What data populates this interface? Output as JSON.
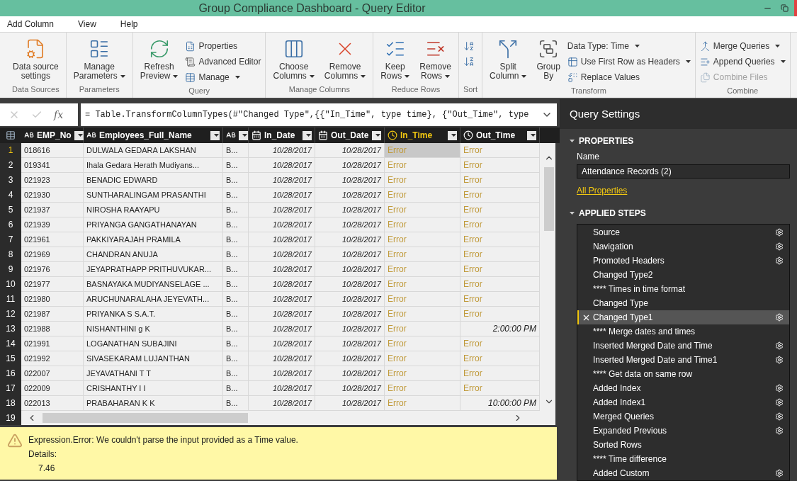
{
  "window": {
    "title": "Group Compliance Dashboard - Query Editor"
  },
  "menu": [
    {
      "label": "Add Column",
      "selected": false
    },
    {
      "label": "View",
      "selected": false
    },
    {
      "label": "Help",
      "selected": false
    }
  ],
  "ribbon": [
    {
      "label": "Data Sources",
      "items": [
        {
          "kind": "large",
          "lines": [
            "Data source",
            "settings"
          ],
          "dropdown": false
        }
      ]
    },
    {
      "label": "Parameters",
      "items": [
        {
          "kind": "large",
          "lines": [
            "Manage",
            "Parameters"
          ],
          "dropdown": true
        }
      ]
    },
    {
      "label": "Query",
      "items": [
        {
          "kind": "large",
          "lines": [
            "Refresh",
            "Preview"
          ],
          "dropdown": true
        },
        {
          "kind": "small",
          "label": "Properties",
          "dropdown": false,
          "disabled": false
        },
        {
          "kind": "small",
          "label": "Advanced Editor",
          "dropdown": false,
          "disabled": false
        },
        {
          "kind": "small",
          "label": "Manage",
          "dropdown": true,
          "disabled": false
        }
      ]
    },
    {
      "label": "Manage Columns",
      "items": [
        {
          "kind": "large",
          "lines": [
            "Choose",
            "Columns"
          ],
          "dropdown": true
        },
        {
          "kind": "large",
          "lines": [
            "Remove",
            "Columns"
          ],
          "dropdown": true
        }
      ]
    },
    {
      "label": "Reduce Rows",
      "items": [
        {
          "kind": "large",
          "lines": [
            "Keep",
            "Rows"
          ],
          "dropdown": true
        },
        {
          "kind": "large",
          "lines": [
            "Remove",
            "Rows"
          ],
          "dropdown": true
        }
      ]
    },
    {
      "label": "Sort",
      "items": [
        {
          "kind": "icon"
        },
        {
          "kind": "icon"
        }
      ]
    },
    {
      "label": "Transform",
      "items": [
        {
          "kind": "large",
          "lines": [
            "Split",
            "Column"
          ],
          "dropdown": true
        },
        {
          "kind": "large",
          "lines": [
            "Group",
            "By"
          ],
          "dropdown": false
        },
        {
          "kind": "small",
          "label": "Data Type: Time",
          "dropdown": true,
          "disabled": false
        },
        {
          "kind": "small",
          "label": "Use First Row as Headers",
          "dropdown": true,
          "disabled": false
        },
        {
          "kind": "small",
          "label": "Replace Values",
          "dropdown": false,
          "disabled": false
        }
      ]
    },
    {
      "label": "Combine",
      "items": [
        {
          "kind": "small",
          "label": "Merge Queries",
          "dropdown": true,
          "disabled": false
        },
        {
          "kind": "small",
          "label": "Append Queries",
          "dropdown": true,
          "disabled": false
        },
        {
          "kind": "small",
          "label": "Combine Files",
          "dropdown": false,
          "disabled": true
        }
      ]
    }
  ],
  "formula_bar": {
    "fx": "fx",
    "formula": "= Table.TransformColumnTypes(#\"Changed Type\",{{\"In_Time\", type time}, {\"Out_Time\", type"
  },
  "table": {
    "columns": [
      {
        "label": "EMP_No",
        "kind": "text",
        "selected": false
      },
      {
        "label": "Employees_Full_Name",
        "kind": "text",
        "selected": false
      },
      {
        "kind": "text",
        "selected": false
      },
      {
        "label": "In_Date",
        "kind": "date",
        "selected": false
      },
      {
        "label": "Out_Date",
        "kind": "date",
        "selected": false
      },
      {
        "label": "In_Time",
        "kind": "time",
        "selected": true
      },
      {
        "label": "Out_Time",
        "kind": "time",
        "selected": false
      }
    ],
    "rows": [
      {
        "number": "1",
        "selected": true,
        "cells": [
          "018616",
          "DULWALA GEDARA LAKSHAN",
          "B...",
          "10/28/2017",
          "10/28/2017"
        ],
        "in_time": {
          "value": "Error",
          "kind": "error",
          "selected": true
        },
        "out_time": {
          "value": "Error",
          "kind": "error",
          "selected": false
        }
      },
      {
        "number": "2",
        "selected": false,
        "cells": [
          "019341",
          "Ihala Gedara Herath Mudiyans...",
          "B...",
          "10/28/2017",
          "10/28/2017"
        ],
        "in_time": {
          "value": "Error",
          "kind": "error",
          "selected": false
        },
        "out_time": {
          "value": "Error",
          "kind": "error",
          "selected": false
        }
      },
      {
        "number": "3",
        "selected": false,
        "cells": [
          "021923",
          "BENADIC EDWARD",
          "B...",
          "10/28/2017",
          "10/28/2017"
        ],
        "in_time": {
          "value": "Error",
          "kind": "error",
          "selected": false
        },
        "out_time": {
          "value": "Error",
          "kind": "error",
          "selected": false
        }
      },
      {
        "number": "4",
        "selected": false,
        "cells": [
          "021930",
          "SUNTHARALINGAM PRASANTHI",
          "B...",
          "10/28/2017",
          "10/28/2017"
        ],
        "in_time": {
          "value": "Error",
          "kind": "error",
          "selected": false
        },
        "out_time": {
          "value": "Error",
          "kind": "error",
          "selected": false
        }
      },
      {
        "number": "5",
        "selected": false,
        "cells": [
          "021937",
          "NIROSHA RAAYAPU",
          "B...",
          "10/28/2017",
          "10/28/2017"
        ],
        "in_time": {
          "value": "Error",
          "kind": "error",
          "selected": false
        },
        "out_time": {
          "value": "Error",
          "kind": "error",
          "selected": false
        }
      },
      {
        "number": "6",
        "selected": false,
        "cells": [
          "021939",
          "PRIYANGA GANGATHANAYAN",
          "B...",
          "10/28/2017",
          "10/28/2017"
        ],
        "in_time": {
          "value": "Error",
          "kind": "error",
          "selected": false
        },
        "out_time": {
          "value": "Error",
          "kind": "error",
          "selected": false
        }
      },
      {
        "number": "7",
        "selected": false,
        "cells": [
          "021961",
          "PAKKIYARAJAH PRAMILA",
          "B...",
          "10/28/2017",
          "10/28/2017"
        ],
        "in_time": {
          "value": "Error",
          "kind": "error",
          "selected": false
        },
        "out_time": {
          "value": "Error",
          "kind": "error",
          "selected": false
        }
      },
      {
        "number": "8",
        "selected": false,
        "cells": [
          "021969",
          "CHANDRAN ANUJA",
          "B...",
          "10/28/2017",
          "10/28/2017"
        ],
        "in_time": {
          "value": "Error",
          "kind": "error",
          "selected": false
        },
        "out_time": {
          "value": "Error",
          "kind": "error",
          "selected": false
        }
      },
      {
        "number": "9",
        "selected": false,
        "cells": [
          "021976",
          "JEYAPRATHAPP PRITHUVUKAR...",
          "B...",
          "10/28/2017",
          "10/28/2017"
        ],
        "in_time": {
          "value": "Error",
          "kind": "error",
          "selected": false
        },
        "out_time": {
          "value": "Error",
          "kind": "error",
          "selected": false
        }
      },
      {
        "number": "10",
        "selected": false,
        "cells": [
          "021977",
          "BASNAYAKA MUDIYANSELAGE ...",
          "B...",
          "10/28/2017",
          "10/28/2017"
        ],
        "in_time": {
          "value": "Error",
          "kind": "error",
          "selected": false
        },
        "out_time": {
          "value": "Error",
          "kind": "error",
          "selected": false
        }
      },
      {
        "number": "11",
        "selected": false,
        "cells": [
          "021980",
          "ARUCHUNARALAHA JEYEVATH...",
          "B...",
          "10/28/2017",
          "10/28/2017"
        ],
        "in_time": {
          "value": "Error",
          "kind": "error",
          "selected": false
        },
        "out_time": {
          "value": "Error",
          "kind": "error",
          "selected": false
        }
      },
      {
        "number": "12",
        "selected": false,
        "cells": [
          "021987",
          "PRIYANKA S S.A.T.",
          "B...",
          "10/28/2017",
          "10/28/2017"
        ],
        "in_time": {
          "value": "Error",
          "kind": "error",
          "selected": false
        },
        "out_time": {
          "value": "Error",
          "kind": "error",
          "selected": false
        }
      },
      {
        "number": "13",
        "selected": false,
        "cells": [
          "021988",
          "NISHANTHINI g K",
          "B...",
          "10/28/2017",
          "10/28/2017"
        ],
        "in_time": {
          "value": "Error",
          "kind": "error",
          "selected": false
        },
        "out_time": {
          "value": "2:00:00 PM",
          "kind": "time",
          "selected": false
        }
      },
      {
        "number": "14",
        "selected": false,
        "cells": [
          "021991",
          "LOGANATHAN SUBAJINI",
          "B...",
          "10/28/2017",
          "10/28/2017"
        ],
        "in_time": {
          "value": "Error",
          "kind": "error",
          "selected": false
        },
        "out_time": {
          "value": "Error",
          "kind": "error",
          "selected": false
        }
      },
      {
        "number": "15",
        "selected": false,
        "cells": [
          "021992",
          "SIVASEKARAM LUJANTHAN",
          "B...",
          "10/28/2017",
          "10/28/2017"
        ],
        "in_time": {
          "value": "Error",
          "kind": "error",
          "selected": false
        },
        "out_time": {
          "value": "Error",
          "kind": "error",
          "selected": false
        }
      },
      {
        "number": "16",
        "selected": false,
        "cells": [
          "022007",
          "JEYAVATHANI T T",
          "B...",
          "10/28/2017",
          "10/28/2017"
        ],
        "in_time": {
          "value": "Error",
          "kind": "error",
          "selected": false
        },
        "out_time": {
          "value": "Error",
          "kind": "error",
          "selected": false
        }
      },
      {
        "number": "17",
        "selected": false,
        "cells": [
          "022009",
          "CRISHANTHY I I",
          "B...",
          "10/28/2017",
          "10/28/2017"
        ],
        "in_time": {
          "value": "Error",
          "kind": "error",
          "selected": false
        },
        "out_time": {
          "value": "Error",
          "kind": "error",
          "selected": false
        }
      },
      {
        "number": "18",
        "selected": false,
        "cells": [
          "022013",
          "PRABAHARAN K K",
          "B...",
          "10/28/2017",
          "10/28/2017"
        ],
        "in_time": {
          "value": "Error",
          "kind": "error",
          "selected": false
        },
        "out_time": {
          "value": "10:00:00 PM",
          "kind": "time",
          "selected": false
        }
      }
    ],
    "partial_row_number": "19"
  },
  "error_pane": {
    "message": "Expression.Error: We couldn't parse the input provided as a Time value.",
    "details_label": "Details:",
    "details": "7.46"
  },
  "query_settings": {
    "title": "Query Settings",
    "properties": {
      "heading": "PROPERTIES",
      "expanded": true,
      "name_label": "Name",
      "name_value": "Attendance Records (2)",
      "link": "All Properties"
    },
    "applied_steps": {
      "heading": "APPLIED STEPS",
      "expanded": true,
      "steps": [
        {
          "label": "Source",
          "gear": true,
          "selected": false
        },
        {
          "label": "Navigation",
          "gear": true,
          "selected": false
        },
        {
          "label": "Promoted Headers",
          "gear": true,
          "selected": false
        },
        {
          "label": "Changed Type2",
          "gear": false,
          "selected": false
        },
        {
          "label": "**** Times in time format",
          "gear": false,
          "selected": false
        },
        {
          "label": "Changed Type",
          "gear": false,
          "selected": false
        },
        {
          "label": "Changed Type1",
          "gear": true,
          "selected": true
        },
        {
          "label": "**** Merge dates and times",
          "gear": false,
          "selected": false
        },
        {
          "label": "Inserted Merged Date and Time",
          "gear": true,
          "selected": false
        },
        {
          "label": "Inserted Merged Date and Time1",
          "gear": true,
          "selected": false
        },
        {
          "label": "**** Get data on same row",
          "gear": false,
          "selected": false
        },
        {
          "label": "Added Index",
          "gear": true,
          "selected": false
        },
        {
          "label": "Added Index1",
          "gear": true,
          "selected": false
        },
        {
          "label": "Merged Queries",
          "gear": true,
          "selected": false
        },
        {
          "label": "Expanded Previous",
          "gear": true,
          "selected": false
        },
        {
          "label": "Sorted Rows",
          "gear": false,
          "selected": false
        },
        {
          "label": "**** Time difference",
          "gear": false,
          "selected": false
        },
        {
          "label": "Added Custom",
          "gear": true,
          "selected": false
        }
      ]
    }
  }
}
